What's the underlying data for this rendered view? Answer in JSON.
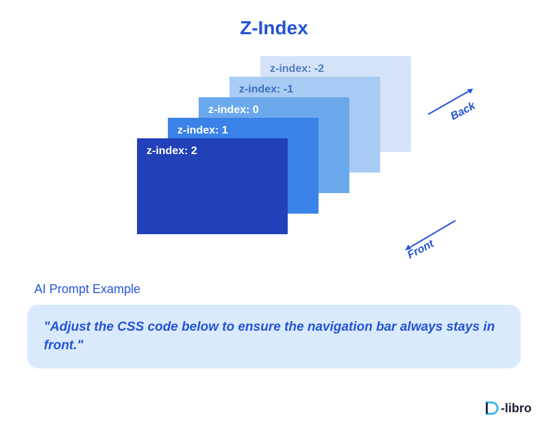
{
  "title": "Z-Index",
  "layers": {
    "neg2": {
      "label": "z-index: -2",
      "color": "#d4e3f8"
    },
    "neg1": {
      "label": "z-index: -1",
      "color": "#a9ccf4"
    },
    "zero": {
      "label": "z-index: 0",
      "color": "#6ba9ed"
    },
    "one": {
      "label": "z-index: 1",
      "color": "#3a82e8"
    },
    "two": {
      "label": "z-index: 2",
      "color": "#2240b8"
    }
  },
  "arrows": {
    "back": "Back",
    "front": "Front"
  },
  "prompt": {
    "heading": "AI Prompt Example",
    "text": "\"Adjust the CSS code below to ensure the navigation bar always stays in front.\""
  },
  "logo": {
    "text": "-libro"
  }
}
